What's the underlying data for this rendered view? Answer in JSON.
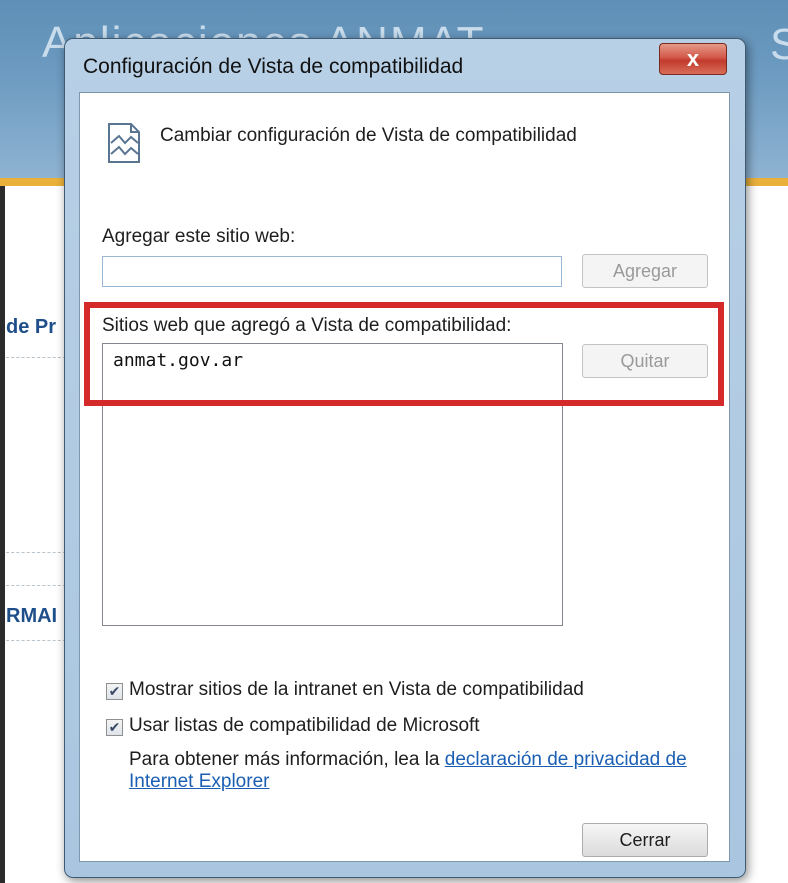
{
  "background": {
    "site_title": "Aplicaciones ANMAT",
    "site_title_right_fragment": "S",
    "fragment_1": "de Pr",
    "fragment_2": "RMAI"
  },
  "dialog": {
    "title": "Configuración de Vista de compatibilidad",
    "close_label": "x",
    "header_text": "Cambiar configuración de Vista de compatibilidad",
    "add_site_label": "Agregar este sitio web:",
    "add_site_value": "",
    "add_button_label": "Agregar",
    "list_label": "Sitios web que agregó a Vista de compatibilidad:",
    "sites": [
      "anmat.gov.ar"
    ],
    "remove_button_label": "Quitar",
    "checkbox_intranet": {
      "label": "Mostrar sitios de la intranet en Vista de compatibilidad",
      "checked": true
    },
    "checkbox_microsoft": {
      "label": "Usar listas de compatibilidad de Microsoft",
      "checked": true
    },
    "info_text": "Para obtener más información, lea la ",
    "info_link_line1": "declaración de privacidad de",
    "info_link_line2": "Internet Explorer",
    "close_button_label": "Cerrar"
  },
  "colors": {
    "highlight": "#d42a2a",
    "link": "#1a5fb4",
    "header_blue": "#6e9cc2",
    "header_stripe": "#e9b13a"
  }
}
